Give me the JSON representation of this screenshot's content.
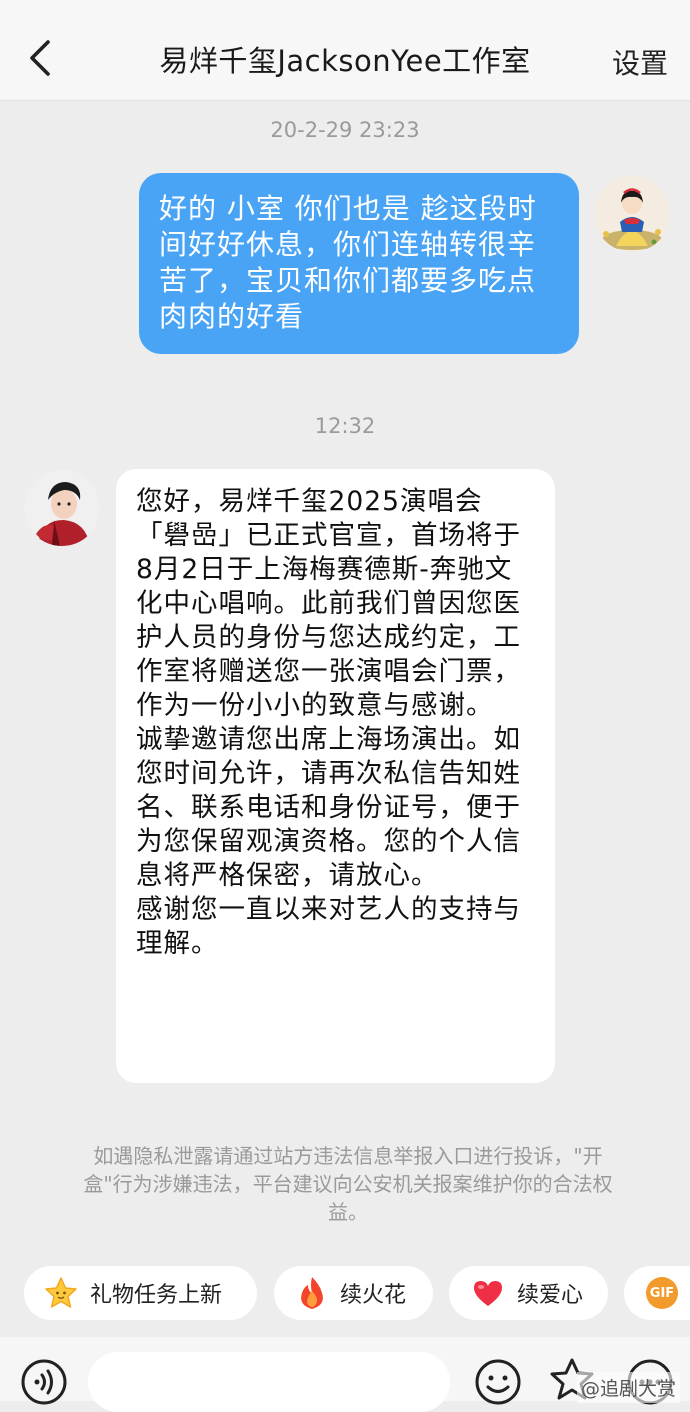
{
  "header": {
    "title": "易烊千玺JacksonYee工作室",
    "settings_label": "设置"
  },
  "messages": {
    "time_1": "20-2-29 23:23",
    "outgoing_text": "好的 小室 你们也是 趁这段时间好好休息，你们连轴转很辛苦了，宝贝和你们都要多吃点肉肉的好看",
    "time_2": "12:32",
    "incoming_text": "您好，易烊千玺2025演唱会「礐嵒」已正式官宣，首场将于8月2日于上海梅赛德斯-奔驰文化中心唱响。此前我们曾因您医护人员的身份与您达成约定，工作室将赠送您一张演唱会门票，作为一份小小的致意与感谢。\n诚挚邀请您出席上海场演出。如您时间允许，请再次私信告知姓名、联系电话和身份证号，便于为您保留观演资格。您的个人信息将严格保密，请放心。\n感谢您一直以来对艺人的支持与理解。"
  },
  "notice": "如遇隐私泄露请通过站方违法信息举报入口进行投诉，\"开盒\"行为涉嫌违法，平台建议向公安机关报案维护你的合法权益。",
  "quick_actions": [
    {
      "label": "礼物任务上新",
      "icon": "star-icon"
    },
    {
      "label": "续火花",
      "icon": "fire-icon"
    },
    {
      "label": "续爱心",
      "icon": "heart-icon"
    },
    {
      "label": "GIF",
      "icon": "gif-icon"
    }
  ],
  "input_bar": {
    "placeholder": "",
    "icons": [
      "voice-icon",
      "emoji-icon",
      "sticker-icon",
      "more-icon"
    ]
  },
  "watermark": "@追剧大赏",
  "colors": {
    "outgoing_bubble": "#49a4f5",
    "background": "#ededed",
    "gif_badge": "#f39a2c"
  }
}
